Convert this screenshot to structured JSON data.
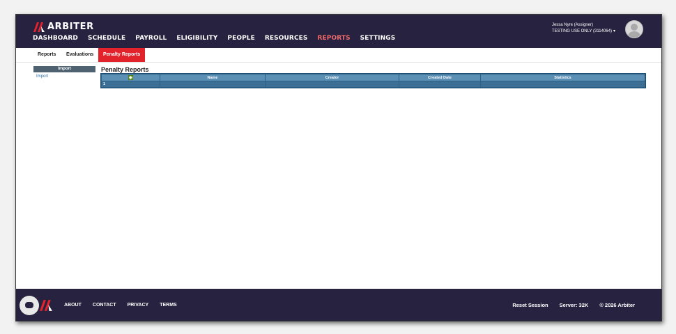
{
  "app": {
    "brand": "ARBITER"
  },
  "nav": {
    "items": [
      "DASHBOARD",
      "SCHEDULE",
      "PAYROLL",
      "ELIGIBILITY",
      "PEOPLE",
      "RESOURCES",
      "REPORTS",
      "SETTINGS"
    ],
    "active": "REPORTS"
  },
  "user": {
    "name": "Jessa Nyre (Assigner)",
    "account": "TESTING USE ONLY (3114064)",
    "caret": "▾"
  },
  "subnav": {
    "reports": "Reports",
    "evaluations": "Evaluations",
    "penalty_reports": "Penalty Reports"
  },
  "sidebar": {
    "header": "Import",
    "link": "Import"
  },
  "main": {
    "title": "Penalty Reports",
    "columns": [
      "Name",
      "Creator",
      "Created Date",
      "Statistics"
    ],
    "rows": [
      [
        "1",
        "",
        "",
        "",
        ""
      ]
    ]
  },
  "footer": {
    "links": [
      "ABOUT",
      "CONTACT",
      "PRIVACY",
      "TERMS"
    ],
    "reset": "Reset Session",
    "server": "Server: 32K",
    "copyright": "© 2026 Arbiter"
  },
  "colors": {
    "header_bg": "#26223f",
    "accent_red": "#e3232c",
    "grid_header": "#5b8fb4",
    "grid_row": "#3b6f96"
  },
  "icons": {
    "logo": "arbiter-logo-icon",
    "add": "add-report-icon",
    "chat": "chat-icon",
    "avatar": "user-avatar-icon"
  }
}
